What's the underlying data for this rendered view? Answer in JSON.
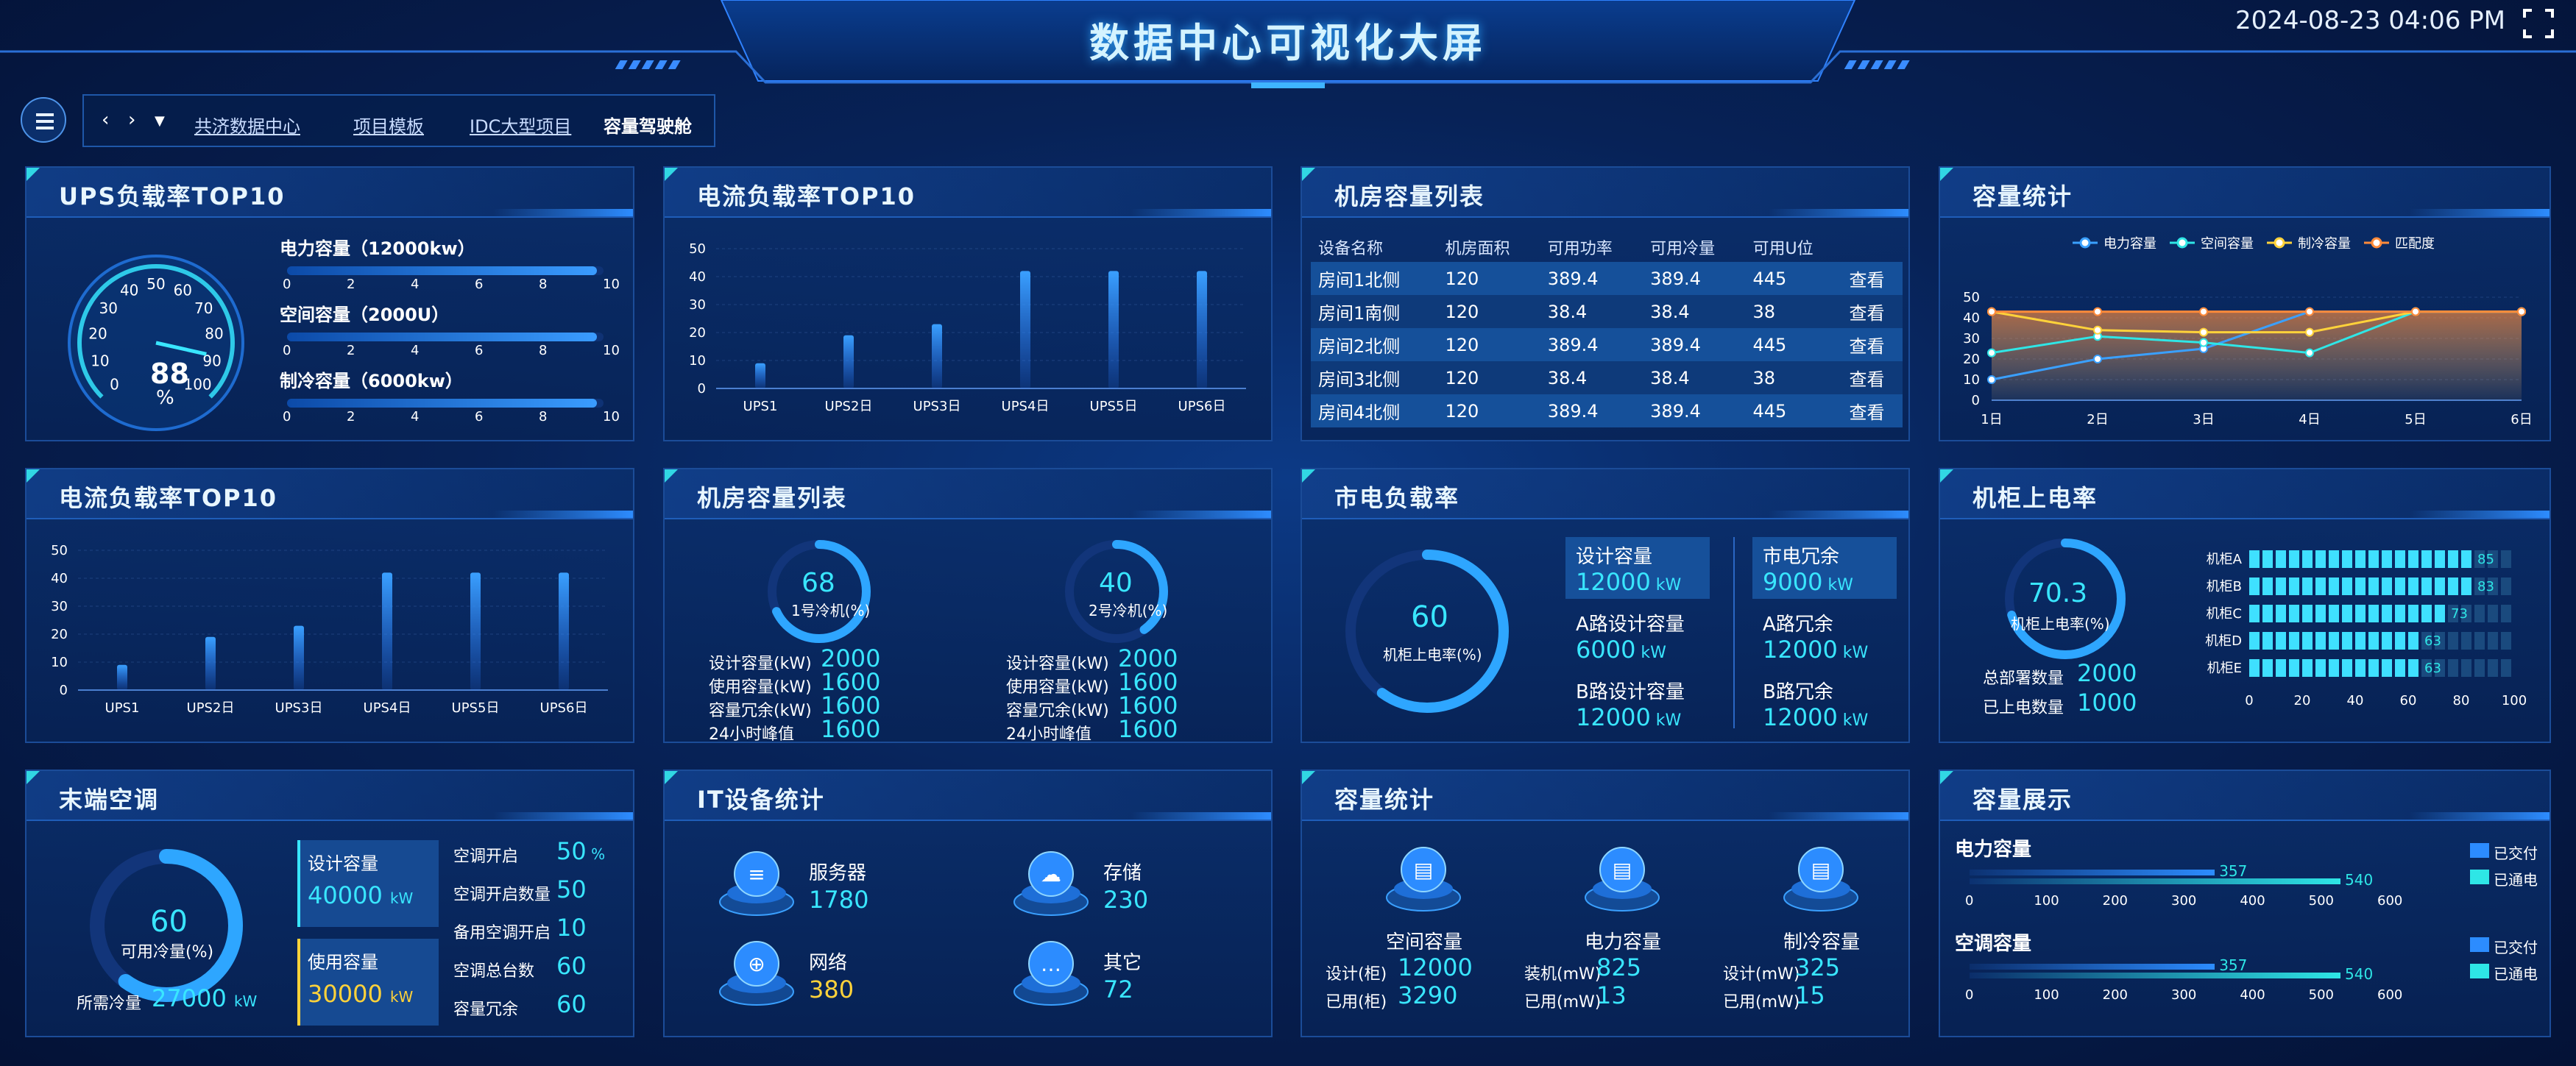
{
  "header": {
    "title": "数据中心可视化大屏",
    "datetime": "2024-08-23 04:06 PM"
  },
  "breadcrumb": {
    "items": [
      "共济数据中心",
      "项目模板",
      "IDC大型项目"
    ],
    "current": "容量驾驶舱"
  },
  "ups": {
    "title": "UPS负载率TOP10",
    "gauge_value": "88",
    "gauge_unit": "%",
    "gauge_ticks": [
      "0",
      "10",
      "20",
      "30",
      "40",
      "50",
      "60",
      "70",
      "80",
      "90",
      "100"
    ],
    "bars": [
      {
        "label": "电力容量（12000kw）",
        "fill": 0.98
      },
      {
        "label": "空间容量（2000U）",
        "fill": 0.98
      },
      {
        "label": "制冷容量（6000kw）",
        "fill": 0.98
      }
    ],
    "bar_ticks": [
      "0",
      "2",
      "4",
      "6",
      "8",
      "10"
    ]
  },
  "current1": {
    "title": "电流负载率TOP10",
    "chart_data": {
      "type": "bar",
      "categories": [
        "UPS1",
        "UPS2日",
        "UPS3日",
        "UPS4日",
        "UPS5日",
        "UPS6日"
      ],
      "values": [
        9,
        19,
        23,
        42,
        42,
        42
      ],
      "ylim": [
        0,
        50
      ],
      "yticks": [
        "0",
        "10",
        "20",
        "30",
        "40",
        "50"
      ]
    }
  },
  "current2": {
    "title": "电流负载率TOP10",
    "chart_data": {
      "type": "bar",
      "categories": [
        "UPS1",
        "UPS2日",
        "UPS3日",
        "UPS4日",
        "UPS5日",
        "UPS6日"
      ],
      "values": [
        9,
        19,
        23,
        42,
        42,
        42
      ],
      "ylim": [
        0,
        50
      ],
      "yticks": [
        "0",
        "10",
        "20",
        "30",
        "40",
        "50"
      ]
    }
  },
  "room_table": {
    "title": "机房容量列表",
    "columns": [
      "设备名称",
      "机房面积",
      "可用功率",
      "可用冷量",
      "可用U位"
    ],
    "rows": [
      [
        "房间1北侧",
        "120",
        "389.4",
        "389.4",
        "445"
      ],
      [
        "房间1南侧",
        "120",
        "38.4",
        "38.4",
        "38"
      ],
      [
        "房间2北侧",
        "120",
        "389.4",
        "389.4",
        "445"
      ],
      [
        "房间3北侧",
        "120",
        "38.4",
        "38.4",
        "38"
      ],
      [
        "房间4北侧",
        "120",
        "389.4",
        "389.4",
        "445"
      ]
    ],
    "action": "查看"
  },
  "capacity_stats": {
    "title": "容量统计",
    "chart_data": {
      "type": "line",
      "x": [
        "1日",
        "2日",
        "3日",
        "4日",
        "5日",
        "6日"
      ],
      "ylim": [
        0,
        50
      ],
      "yticks": [
        "0",
        "10",
        "20",
        "30",
        "40",
        "50"
      ],
      "series": [
        {
          "name": "电力容量",
          "color": "#3aa0ff",
          "values": [
            10,
            20,
            25,
            43,
            43,
            43
          ]
        },
        {
          "name": "空间容量",
          "color": "#2fe6e6",
          "values": [
            23,
            31,
            28,
            23,
            43,
            43
          ]
        },
        {
          "name": "制冷容量",
          "color": "#ffd23a",
          "values": [
            43,
            34,
            33,
            33,
            43,
            43
          ]
        },
        {
          "name": "匹配度",
          "color": "#ff8a3a",
          "values": [
            43,
            43,
            43,
            43,
            43,
            43
          ]
        }
      ]
    }
  },
  "chillers": {
    "title": "机房容量列表",
    "items": [
      {
        "value": "68",
        "name": "1号冷机(%)",
        "pct": 0.68,
        "rows": [
          [
            "设计容量(kW)",
            "2000"
          ],
          [
            "使用容量(kW)",
            "1600"
          ],
          [
            "容量冗余(kW)",
            "1600"
          ],
          [
            "24小时峰值",
            "1600"
          ]
        ]
      },
      {
        "value": "40",
        "name": "2号冷机(%)",
        "pct": 0.4,
        "rows": [
          [
            "设计容量(kW)",
            "2000"
          ],
          [
            "使用容量(kW)",
            "1600"
          ],
          [
            "容量冗余(kW)",
            "1600"
          ],
          [
            "24小时峰值",
            "1600"
          ]
        ]
      }
    ]
  },
  "mains": {
    "title": "市电负载率",
    "value": "60",
    "label": "机柜上电率(%)",
    "pct": 0.6,
    "left": [
      {
        "k": "设计容量",
        "v": "12000",
        "u": "kW"
      },
      {
        "k": "A路设计容量",
        "v": "6000",
        "u": "kW"
      },
      {
        "k": "B路设计容量",
        "v": "12000",
        "u": "kW"
      }
    ],
    "right": [
      {
        "k": "市电冗余",
        "v": "9000",
        "u": "kW"
      },
      {
        "k": "A路冗余",
        "v": "12000",
        "u": "kW"
      },
      {
        "k": "B路冗余",
        "v": "12000",
        "u": "kW"
      }
    ]
  },
  "rack_power": {
    "title": "机柜上电率",
    "value": "70.3",
    "label": "机柜上电率(%)",
    "pct": 0.703,
    "stats": [
      [
        "总部署数量",
        "2000"
      ],
      [
        "已上电数量",
        "1000"
      ]
    ],
    "chart_data": {
      "type": "bar",
      "categories": [
        "机柜A",
        "机柜B",
        "机柜C",
        "机柜D",
        "机柜E"
      ],
      "values": [
        85,
        83,
        73,
        63,
        63
      ],
      "xlim": [
        0,
        100
      ],
      "xticks": [
        "0",
        "20",
        "40",
        "60",
        "80",
        "100"
      ]
    }
  },
  "terminal_ac": {
    "title": "末端空调",
    "value": "60",
    "label": "可用冷量(%)",
    "pct": 0.6,
    "need_label": "所需冷量",
    "need_value": "27000",
    "need_unit": "kW",
    "boxes": [
      {
        "k": "设计容量",
        "v": "40000",
        "u": "kW"
      },
      {
        "k": "使用容量",
        "v": "30000",
        "u": "kW"
      }
    ],
    "stats": [
      [
        "空调开启",
        "50",
        "%"
      ],
      [
        "空调开启数量",
        "50",
        ""
      ],
      [
        "备用空调开启",
        "10",
        ""
      ],
      [
        "空调总台数",
        "60",
        ""
      ],
      [
        "容量冗余",
        "60",
        ""
      ]
    ]
  },
  "it_stats": {
    "title": "IT设备统计",
    "items": [
      {
        "name": "服务器",
        "value": "1780",
        "icon": "server-icon"
      },
      {
        "name": "存储",
        "value": "230",
        "icon": "cloud-storage-icon"
      },
      {
        "name": "网络",
        "value": "380",
        "icon": "network-icon"
      },
      {
        "name": "其它",
        "value": "72",
        "icon": "more-icon"
      }
    ]
  },
  "capacity_stats2": {
    "title": "容量统计",
    "items": [
      {
        "name": "空间容量",
        "rows": [
          [
            "设计(柜)",
            "12000"
          ],
          [
            "已用(柜)",
            "3290"
          ]
        ]
      },
      {
        "name": "电力容量",
        "rows": [
          [
            "装机(mW)",
            "825"
          ],
          [
            "已用(mW)",
            "13"
          ]
        ]
      },
      {
        "name": "制冷容量",
        "rows": [
          [
            "设计(mW)",
            "325"
          ],
          [
            "已用(mW)",
            "15"
          ]
        ]
      }
    ]
  },
  "capacity_display": {
    "title": "容量展示",
    "legend": [
      "已交付",
      "已通电"
    ],
    "groups": [
      {
        "name": "电力容量",
        "delivered": 357,
        "powered": 540
      },
      {
        "name": "空调容量",
        "delivered": 357,
        "powered": 540
      }
    ],
    "xticks": [
      "0",
      "100",
      "200",
      "300",
      "400",
      "500",
      "600"
    ],
    "xmax": 600
  },
  "colors": {
    "accent": "#39e6ff",
    "bar": "#2c8cff",
    "yellow": "#ffd23a"
  }
}
